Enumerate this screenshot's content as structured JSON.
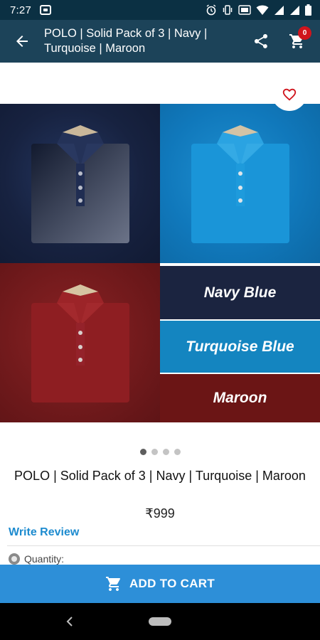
{
  "status_bar": {
    "time": "7:27",
    "icons": [
      "notification-icon",
      "alarm-icon",
      "vibrate-icon",
      "data-saver-icon",
      "wifi-icon",
      "signal-icon",
      "signal-icon",
      "battery-icon"
    ]
  },
  "app_bar": {
    "title": "POLO | Solid Pack of 3 | Navy | Turquoise | Maroon",
    "cart_count": "0",
    "color": "#1c4359"
  },
  "product_image": {
    "colors": [
      {
        "label": "Navy Blue",
        "hex": "#1b2440"
      },
      {
        "label": "Turquoise Blue",
        "hex": "#1485c0"
      },
      {
        "label": "Maroon",
        "hex": "#6b1515"
      }
    ],
    "pager": {
      "total": 4,
      "active": 1
    }
  },
  "product": {
    "title": "POLO | Solid Pack of 3 | Navy | Turquoise | Maroon",
    "price": "₹999",
    "write_review": "Write Review",
    "quantity_label": "Quantity:"
  },
  "actions": {
    "add_to_cart": "ADD TO CART",
    "accent": "#2d8fd8"
  }
}
